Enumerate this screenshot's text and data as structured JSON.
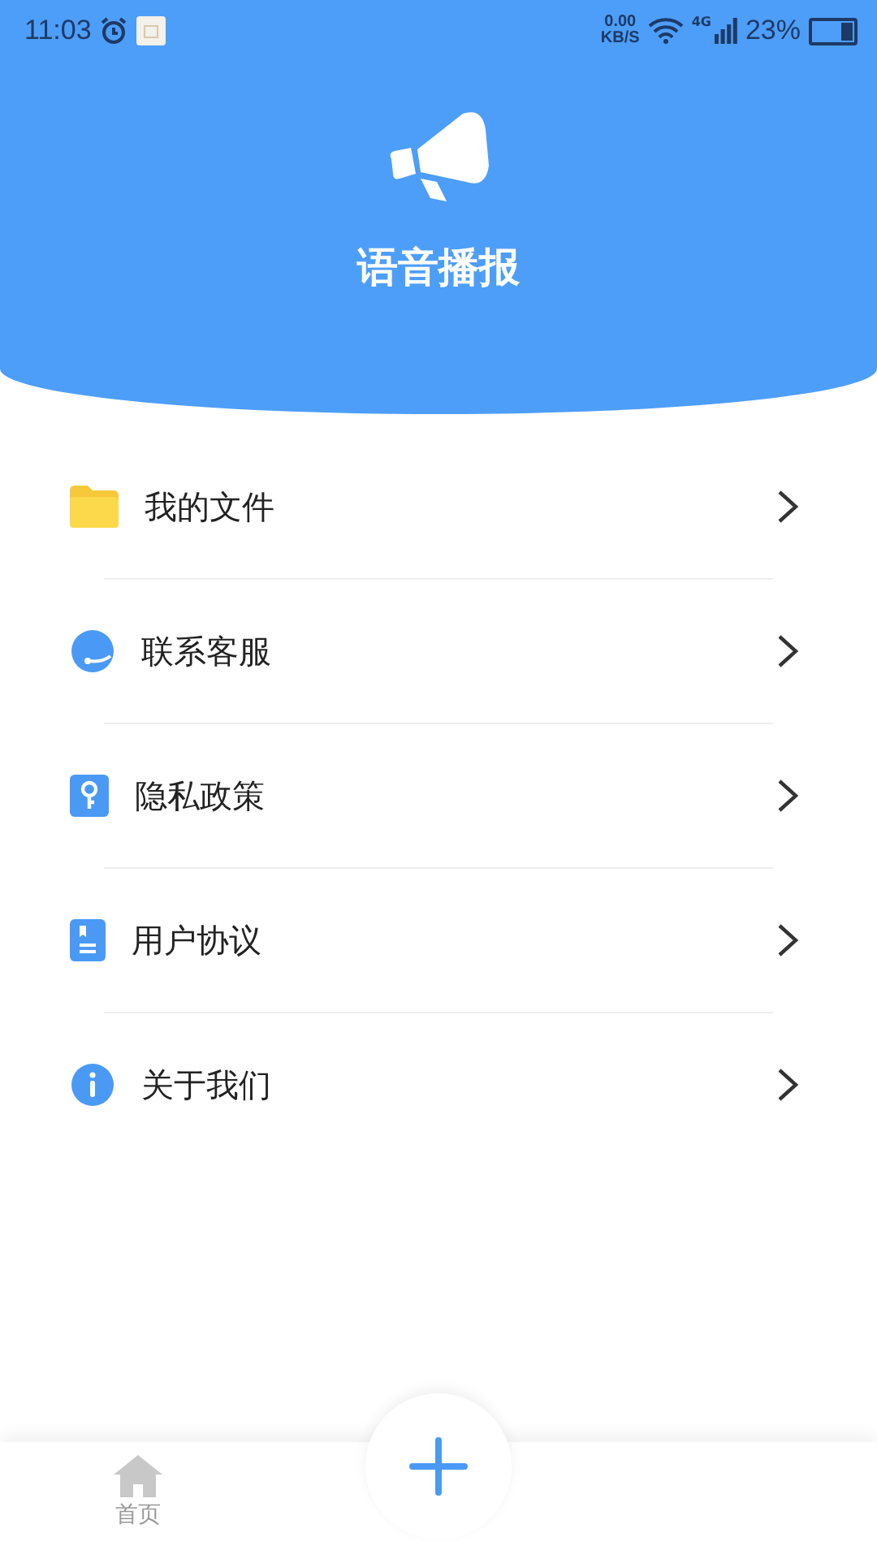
{
  "status_bar": {
    "time": "11:03",
    "net_speed": "0.00",
    "net_unit": "KB/S",
    "network": "4G",
    "battery": "23%"
  },
  "header": {
    "title": "语音播报"
  },
  "menu": [
    {
      "kind": "folder",
      "label": "我的文件"
    },
    {
      "kind": "service",
      "label": "联系客服"
    },
    {
      "kind": "privacy",
      "label": "隐私政策"
    },
    {
      "kind": "agreement",
      "label": "用户协议"
    },
    {
      "kind": "about",
      "label": "关于我们"
    }
  ],
  "bottom_nav": {
    "home_label": "首页"
  }
}
